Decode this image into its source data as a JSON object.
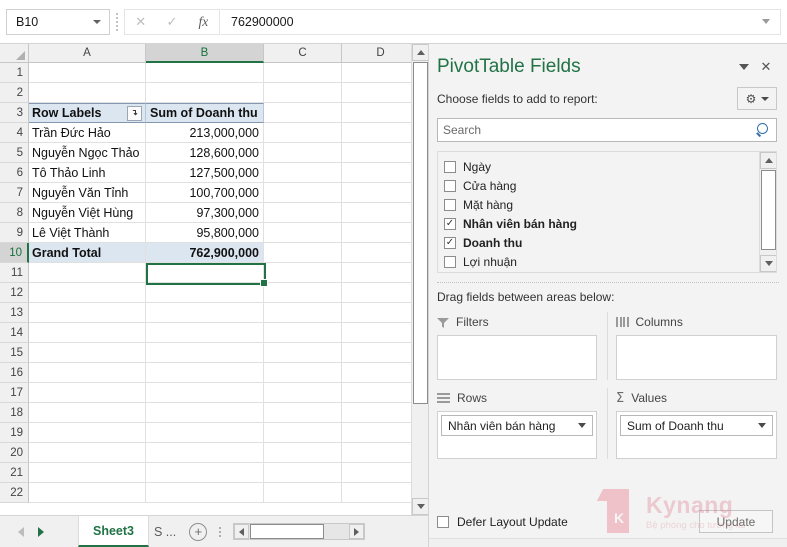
{
  "formula_bar": {
    "name_box_value": "B10",
    "cancel_icon": "close-icon",
    "confirm_icon": "check-icon",
    "function_icon": "fx",
    "value": "762900000",
    "expand_icon": "chevron-down-icon"
  },
  "grid": {
    "columns": [
      "A",
      "B",
      "C",
      "D"
    ],
    "selected_column": "B",
    "selected_cell": "B10",
    "row_numbers": [
      1,
      2,
      3,
      4,
      5,
      6,
      7,
      8,
      9,
      10,
      11,
      12,
      13,
      14,
      15,
      16,
      17,
      18,
      19,
      20,
      21,
      22
    ],
    "pivot": {
      "header_row": 3,
      "row_labels_header": "Row Labels",
      "value_header": "Sum of Doanh thu",
      "filter_icon": "filter-sort-icon",
      "rows": [
        {
          "row": 4,
          "label": "Trần Đức Hảo",
          "value": "213,000,000"
        },
        {
          "row": 5,
          "label": "Nguyễn Ngọc Thảo",
          "value": "128,600,000"
        },
        {
          "row": 6,
          "label": "Tô Thảo Linh",
          "value": "127,500,000"
        },
        {
          "row": 7,
          "label": "Nguyễn Văn Tỉnh",
          "value": "100,700,000"
        },
        {
          "row": 8,
          "label": "Nguyễn Việt Hùng",
          "value": "97,300,000"
        },
        {
          "row": 9,
          "label": "Lê Việt Thành",
          "value": "95,800,000"
        }
      ],
      "grand_total": {
        "row": 10,
        "label": "Grand Total",
        "value": "762,900,000"
      }
    }
  },
  "sheet_tabs": {
    "prev_icon": "nav-prev-icon",
    "next_icon": "nav-next-icon",
    "tabs": [
      {
        "name": "Sheet3",
        "active": true
      },
      {
        "name": "S ...",
        "active": false
      }
    ],
    "new_sheet_icon": "plus-circle-icon",
    "more_icon": "more-options-icon"
  },
  "panel": {
    "title": "PivotTable Fields",
    "minimize_icon": "chevron-down-icon",
    "close_icon": "close-icon",
    "choose_label": "Choose fields to add to report:",
    "tools_icon": "gear-icon",
    "tools_caret_icon": "caret-down-icon",
    "search": {
      "placeholder": "Search",
      "icon": "search-icon"
    },
    "fields": [
      {
        "label": "Ngày",
        "checked": false
      },
      {
        "label": "Cửa hàng",
        "checked": false
      },
      {
        "label": "Mặt hàng",
        "checked": false
      },
      {
        "label": "Nhân viên bán hàng",
        "checked": true
      },
      {
        "label": "Doanh thu",
        "checked": true
      },
      {
        "label": "Lợi nhuận",
        "checked": false
      }
    ],
    "drag_label": "Drag fields between areas below:",
    "areas": {
      "filters": {
        "label": "Filters",
        "icon": "filter-icon",
        "items": []
      },
      "columns": {
        "label": "Columns",
        "icon": "columns-icon",
        "items": []
      },
      "rows": {
        "label": "Rows",
        "icon": "rows-icon",
        "items": [
          "Nhân viên bán hàng"
        ]
      },
      "values": {
        "label": "Values",
        "icon": "sigma-icon",
        "items": [
          "Sum of Doanh thu"
        ]
      }
    },
    "defer_label": "Defer Layout Update",
    "update_label": "Update"
  },
  "watermark": {
    "brand": "Kynang",
    "tagline": "Bệ phóng cho tương lai",
    "logo_letter": "K"
  },
  "colors": {
    "excel_green": "#217346",
    "pivot_header_fill": "#dce6f1",
    "selection_border": "#217346",
    "brand_red": "#e8536a"
  }
}
